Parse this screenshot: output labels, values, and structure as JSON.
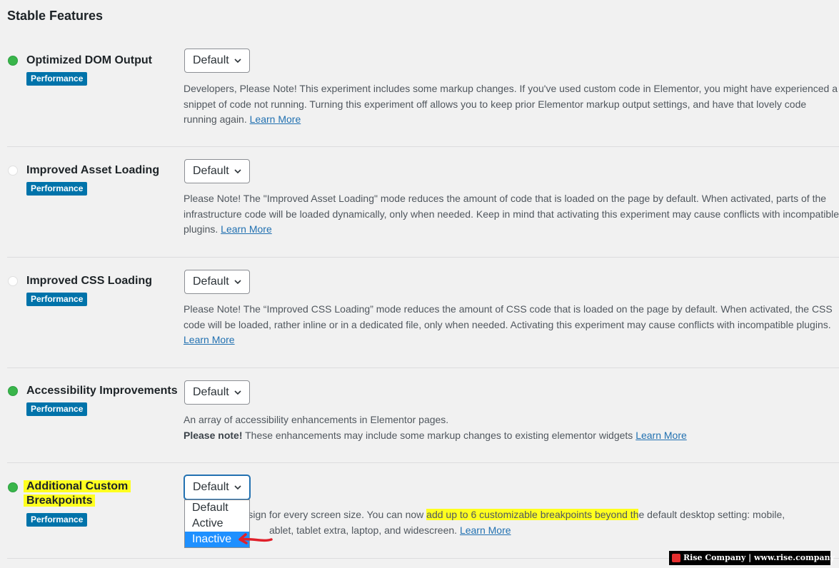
{
  "section_title": "Stable Features",
  "features": [
    {
      "name": "Optimized DOM Output",
      "state": "on",
      "badge": "Performance",
      "select_value": "Default",
      "desc": "Developers, Please Note! This experiment includes some markup changes. If you've used custom code in Elementor, you might have experienced a snippet of code not running. Turning this experiment off allows you to keep prior Elementor markup output settings, and have that lovely code running again.",
      "link": "Learn More"
    },
    {
      "name": "Improved Asset Loading",
      "state": "off",
      "badge": "Performance",
      "select_value": "Default",
      "desc": "Please Note! The \"Improved Asset Loading\" mode reduces the amount of code that is loaded on the page by default. When activated, parts of the infrastructure code will be loaded dynamically, only when needed. Keep in mind that activating this experiment may cause conflicts with incompatible plugins.",
      "link": "Learn More"
    },
    {
      "name": "Improved CSS Loading",
      "state": "off",
      "badge": "Performance",
      "select_value": "Default",
      "desc": "Please Note! The “Improved CSS Loading” mode reduces the amount of CSS code that is loaded on the page by default. When activated, the CSS code will be loaded, rather inline or in a dedicated file, only when needed. Activating this experiment may cause conflicts with incompatible plugins.",
      "link": "Learn More"
    },
    {
      "name": "Accessibility Improvements",
      "state": "on",
      "badge": "Performance",
      "select_value": "Default",
      "desc_line1": "An array of accessibility enhancements in Elementor pages.",
      "desc_bold": "Please note!",
      "desc_line2": " These enhancements may include some markup changes to existing elementor widgets",
      "link": "Learn More"
    },
    {
      "name": "Additional Custom Breakpoints",
      "state": "on",
      "badge": "Performance",
      "select_value": "Default",
      "desc_visible_a": "ct design for every screen size. You can now ",
      "desc_highlight": "add up to 6 customizable breakpoints beyond th",
      "desc_visible_b": "e default desktop setting: mobile,",
      "desc_visible_c": "ablet, tablet extra, laptop, and widescreen.",
      "link": "Learn More"
    }
  ],
  "dropdown": {
    "options": [
      "Default",
      "Active",
      "Inactive"
    ],
    "highlighted": "Inactive"
  },
  "watermark": "Rise Company | www.rise.company",
  "colors": {
    "active_dot": "#39b54a",
    "badge": "#0073aa",
    "link": "#2271b1",
    "highlight": "#ffff1f",
    "dropdown_selected": "#1e90ff"
  }
}
